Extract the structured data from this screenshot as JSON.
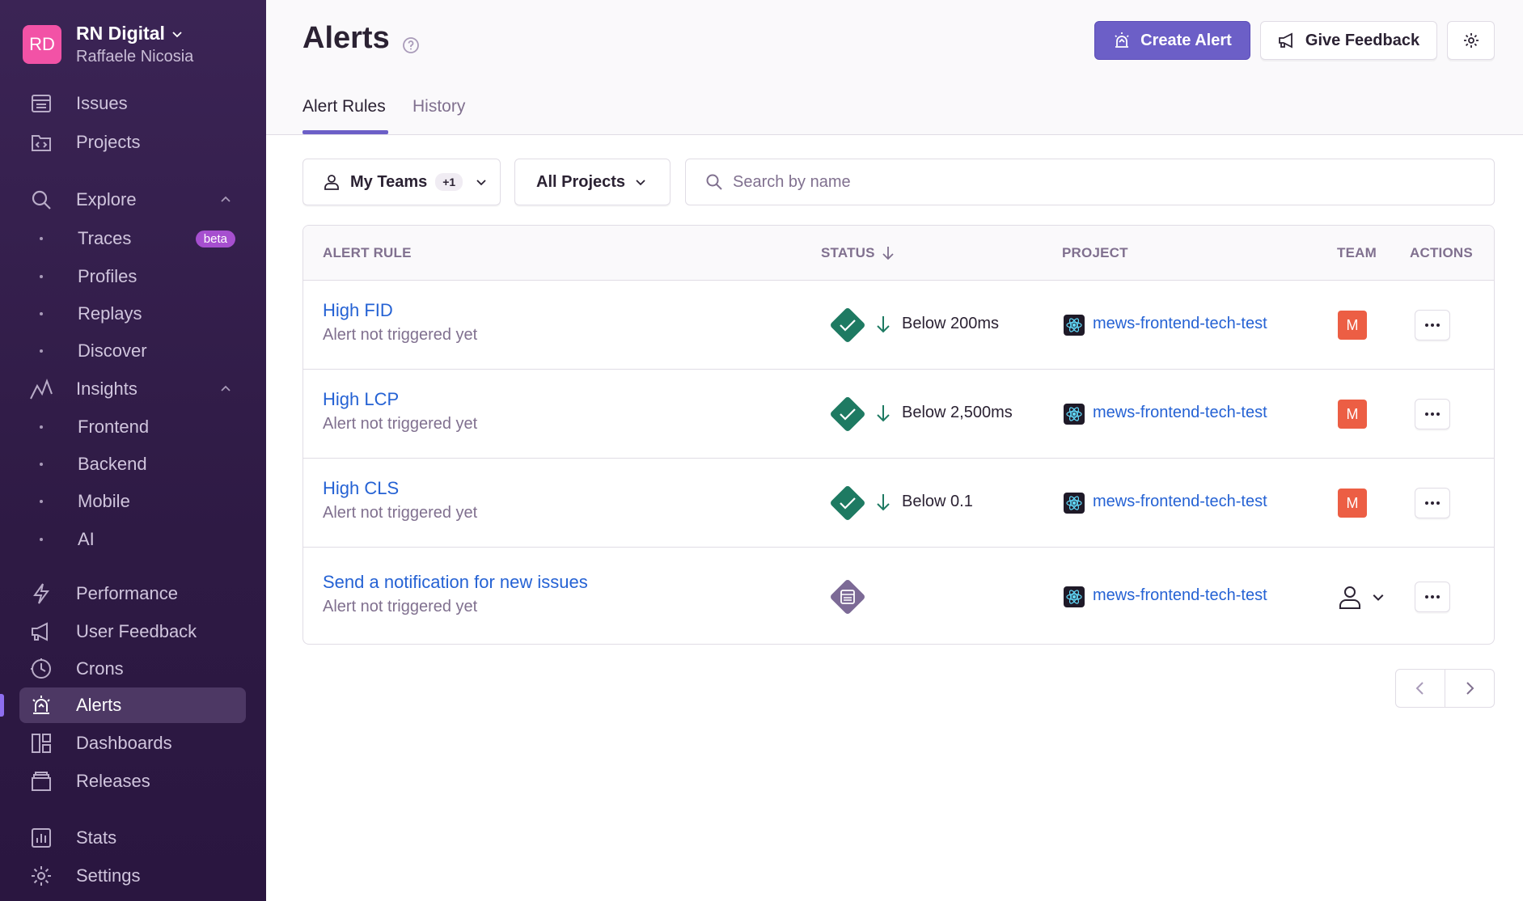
{
  "org": {
    "initials": "RD",
    "name": "RN Digital",
    "user": "Raffaele Nicosia"
  },
  "nav": {
    "issues": "Issues",
    "projects": "Projects",
    "explore": "Explore",
    "traces": "Traces",
    "beta": "beta",
    "profiles": "Profiles",
    "replays": "Replays",
    "discover": "Discover",
    "insights": "Insights",
    "frontend": "Frontend",
    "backend": "Backend",
    "mobile": "Mobile",
    "ai": "AI",
    "performance": "Performance",
    "user_feedback": "User Feedback",
    "crons": "Crons",
    "alerts": "Alerts",
    "dashboards": "Dashboards",
    "releases": "Releases",
    "stats": "Stats",
    "settings": "Settings"
  },
  "header": {
    "title": "Alerts",
    "create_alert": "Create Alert",
    "give_feedback": "Give Feedback",
    "tabs": [
      "Alert Rules",
      "History"
    ]
  },
  "filters": {
    "teams": "My Teams",
    "teams_count": "+1",
    "projects": "All Projects",
    "search_placeholder": "Search by name"
  },
  "table": {
    "columns": [
      "ALERT RULE",
      "STATUS",
      "PROJECT",
      "TEAM",
      "ACTIONS"
    ],
    "rows": [
      {
        "name": "High FID",
        "sub": "Alert not triggered yet",
        "status": "Below 200ms",
        "project": "mews-frontend-tech-test",
        "team": "M"
      },
      {
        "name": "High LCP",
        "sub": "Alert not triggered yet",
        "status": "Below 2,500ms",
        "project": "mews-frontend-tech-test",
        "team": "M"
      },
      {
        "name": "High CLS",
        "sub": "Alert not triggered yet",
        "status": "Below 0.1",
        "project": "mews-frontend-tech-test",
        "team": "M"
      },
      {
        "name": "Send a notification for new issues",
        "sub": "Alert not triggered yet",
        "status": "",
        "project": "mews-frontend-tech-test",
        "team": ""
      }
    ]
  },
  "colors": {
    "accent": "#6c5fc7",
    "link": "#2562d4",
    "status_ok": "#2ba185",
    "team_badge": "#ec5e44",
    "issue_status": "#7c6a96"
  }
}
